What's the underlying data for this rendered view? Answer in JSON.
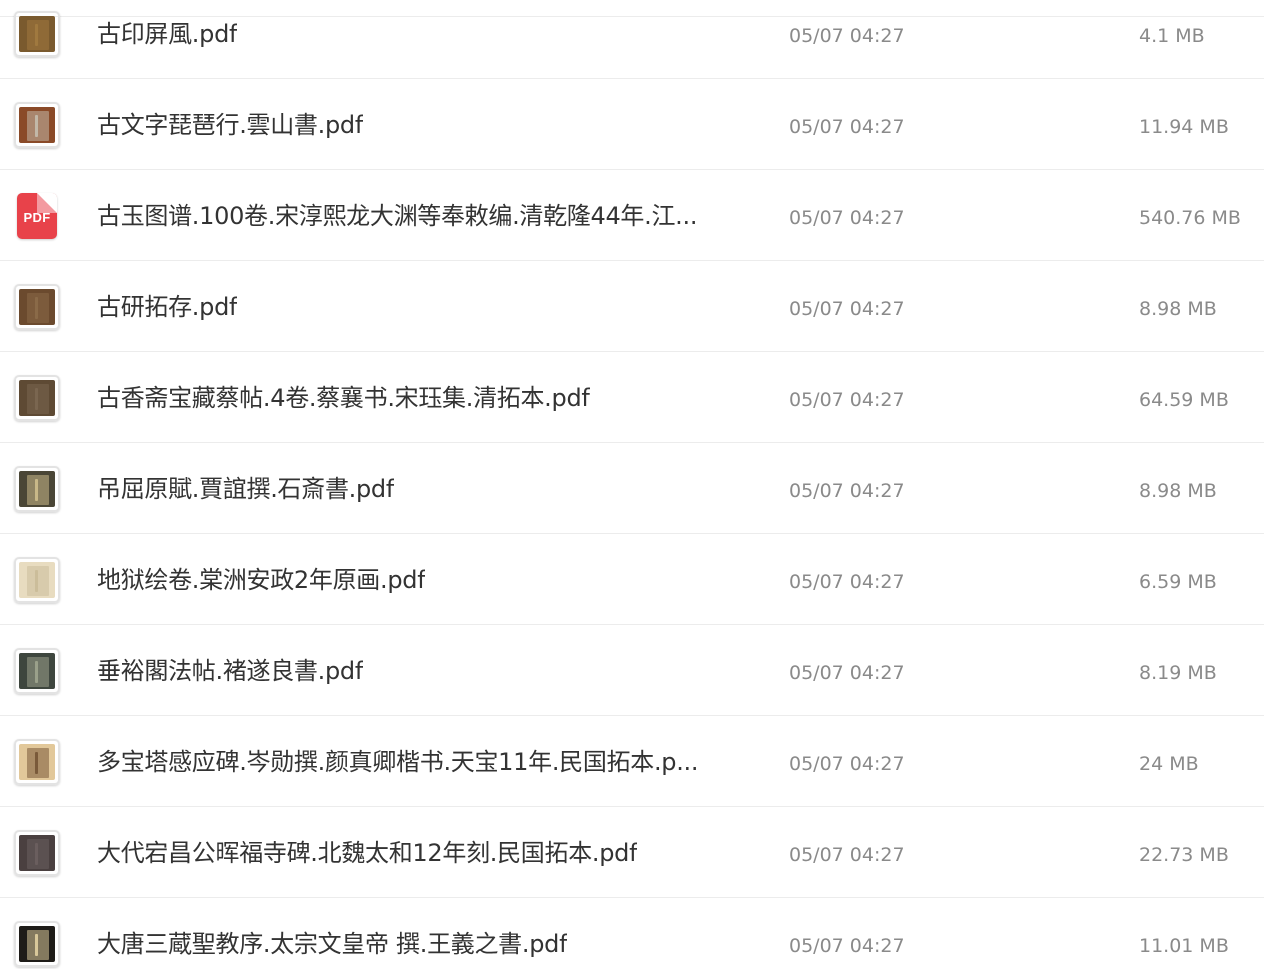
{
  "files": [
    {
      "name": "古印屏風.pdf",
      "date": "05/07 04:27",
      "size": "4.1 MB",
      "thumb": {
        "kind": "image",
        "bg": "#7a5a2e",
        "accent": "#a0793f"
      }
    },
    {
      "name": "古文字琵琶行.雲山書.pdf",
      "date": "05/07 04:27",
      "size": "11.94 MB",
      "thumb": {
        "kind": "image",
        "bg": "#8a4a28",
        "accent": "#c2b8a8"
      }
    },
    {
      "name": "古玉图谱.100卷.宋淳熙龙大渊等奉敕编.清乾隆44年.江...",
      "date": "05/07 04:27",
      "size": "540.76 MB",
      "thumb": {
        "kind": "pdf",
        "label": "PDF",
        "bg": "#e8424a"
      }
    },
    {
      "name": "古研拓存.pdf",
      "date": "05/07 04:27",
      "size": "8.98 MB",
      "thumb": {
        "kind": "image",
        "bg": "#6b4a2e",
        "accent": "#8a6a48"
      }
    },
    {
      "name": "古香斋宝藏蔡帖.4卷.蔡襄书.宋珏集.清拓本.pdf",
      "date": "05/07 04:27",
      "size": "64.59 MB",
      "thumb": {
        "kind": "image",
        "bg": "#5e4a34",
        "accent": "#7a6650"
      }
    },
    {
      "name": "吊屈原賦.賈誼撰.石斎書.pdf",
      "date": "05/07 04:27",
      "size": "8.98 MB",
      "thumb": {
        "kind": "image",
        "bg": "#4a4636",
        "accent": "#c8b888"
      }
    },
    {
      "name": "地狱绘卷.棠洲安政2年原画.pdf",
      "date": "05/07 04:27",
      "size": "6.59 MB",
      "thumb": {
        "kind": "image",
        "bg": "#e8dcc0",
        "accent": "#cbbd9a"
      }
    },
    {
      "name": "垂裕閣法帖.褚遂良書.pdf",
      "date": "05/07 04:27",
      "size": "8.19 MB",
      "thumb": {
        "kind": "image",
        "bg": "#3e463e",
        "accent": "#9aa08a"
      }
    },
    {
      "name": "多宝塔感应碑.岑勋撰.颜真卿楷书.天宝11年.民国拓本.p...",
      "date": "05/07 04:27",
      "size": "24 MB",
      "thumb": {
        "kind": "image",
        "bg": "#e2c89a",
        "accent": "#7a5a3a"
      }
    },
    {
      "name": "大代宕昌公晖福寺碑.北魏太和12年刻.民国拓本.pdf",
      "date": "05/07 04:27",
      "size": "22.73 MB",
      "thumb": {
        "kind": "image",
        "bg": "#4a4040",
        "accent": "#6a5e5e"
      }
    },
    {
      "name": "大唐三蔵聖教序.太宗文皇帝 撰.王義之書.pdf",
      "date": "05/07 04:27",
      "size": "11.01 MB",
      "thumb": {
        "kind": "image",
        "bg": "#1e1c18",
        "accent": "#d8c89a"
      }
    }
  ]
}
